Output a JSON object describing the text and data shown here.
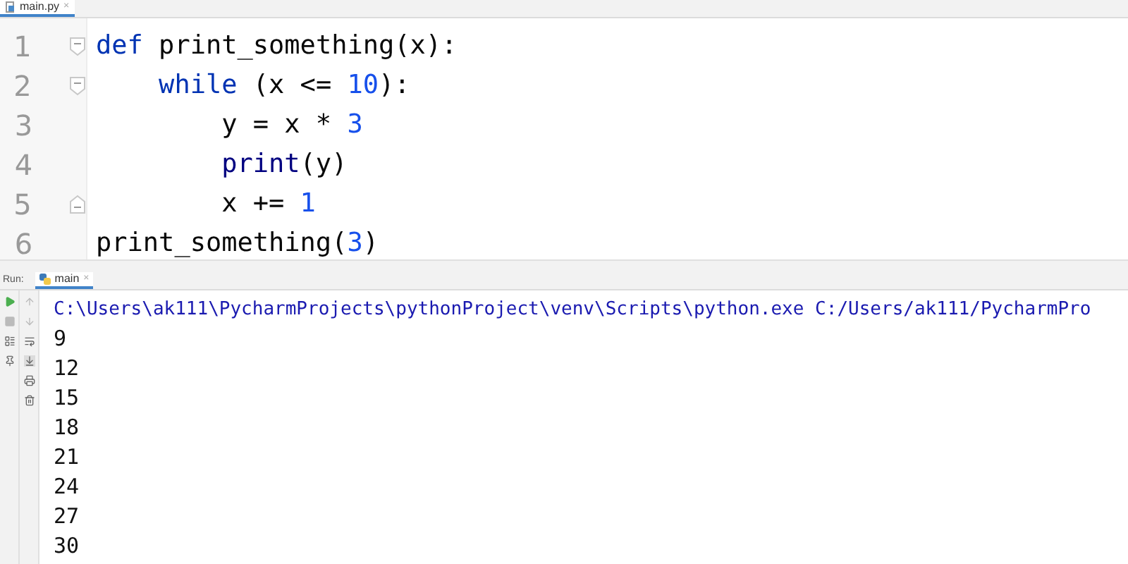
{
  "editor_tab": {
    "label": "main.py",
    "close": "×",
    "selected": true
  },
  "code_lines": [
    {
      "number": "1",
      "fold": {
        "kind": "start"
      },
      "tokens": [
        {
          "text": "def",
          "kind": "keyword"
        },
        {
          "text": " print_something(x):",
          "kind": "plain"
        }
      ]
    },
    {
      "number": "2",
      "fold": {
        "kind": "start"
      },
      "tokens": [
        {
          "text": "    while",
          "kind": "keyword"
        },
        {
          "text": " (x <= ",
          "kind": "plain"
        },
        {
          "text": "10",
          "kind": "number"
        },
        {
          "text": "):",
          "kind": "plain"
        }
      ]
    },
    {
      "number": "3",
      "tokens": [
        {
          "text": "        y = x * ",
          "kind": "plain"
        },
        {
          "text": "3",
          "kind": "number"
        }
      ]
    },
    {
      "number": "4",
      "tokens": [
        {
          "text": "        print",
          "kind": "builtin"
        },
        {
          "text": "(y)",
          "kind": "plain"
        }
      ]
    },
    {
      "number": "5",
      "fold": {
        "kind": "end"
      },
      "tokens": [
        {
          "text": "        x += ",
          "kind": "plain"
        },
        {
          "text": "1",
          "kind": "number"
        }
      ]
    },
    {
      "number": "6",
      "tokens": [
        {
          "text": "print_something(",
          "kind": "plain"
        },
        {
          "text": "3",
          "kind": "number"
        },
        {
          "text": ")",
          "kind": "plain"
        }
      ]
    }
  ],
  "run_panel": {
    "title": "Run:",
    "tab": {
      "label": "main",
      "close": "×",
      "selected": true
    },
    "command": "C:\\Users\\ak111\\PycharmProjects\\pythonProject\\venv\\Scripts\\python.exe C:/Users/ak111/PycharmPro",
    "output": [
      "9",
      "12",
      "15",
      "18",
      "21",
      "24",
      "27",
      "30"
    ]
  }
}
